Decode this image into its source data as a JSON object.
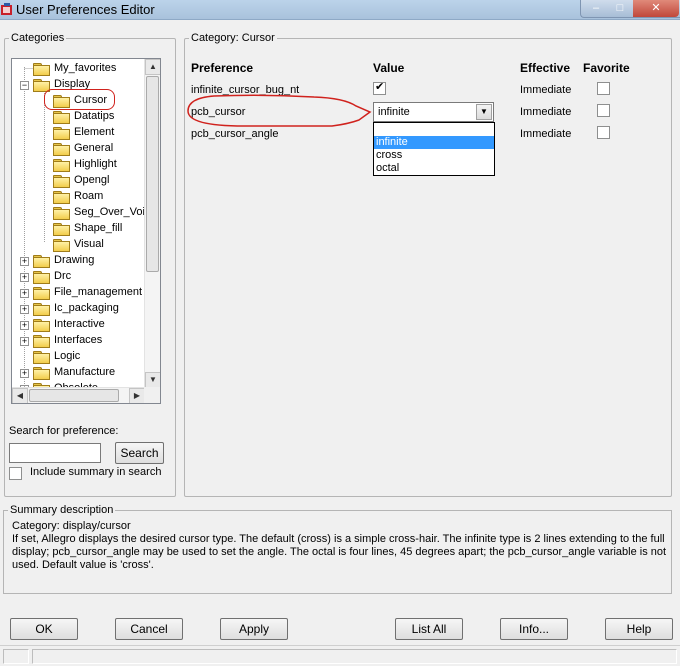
{
  "window": {
    "title": "User Preferences Editor",
    "minimize": "–",
    "maximize": "□",
    "close": "✕"
  },
  "categories": {
    "legend": "Categories",
    "tree": [
      {
        "label": "My_favorites",
        "level": 0,
        "expander": ""
      },
      {
        "label": "Display",
        "level": 0,
        "expander": "−"
      },
      {
        "label": "Cursor",
        "level": 1,
        "expander": "",
        "selected": true
      },
      {
        "label": "Datatips",
        "level": 1,
        "expander": ""
      },
      {
        "label": "Element",
        "level": 1,
        "expander": ""
      },
      {
        "label": "General",
        "level": 1,
        "expander": ""
      },
      {
        "label": "Highlight",
        "level": 1,
        "expander": ""
      },
      {
        "label": "Opengl",
        "level": 1,
        "expander": ""
      },
      {
        "label": "Roam",
        "level": 1,
        "expander": ""
      },
      {
        "label": "Seg_Over_Voi",
        "level": 1,
        "expander": ""
      },
      {
        "label": "Shape_fill",
        "level": 1,
        "expander": ""
      },
      {
        "label": "Visual",
        "level": 1,
        "expander": ""
      },
      {
        "label": "Drawing",
        "level": 0,
        "expander": "+"
      },
      {
        "label": "Drc",
        "level": 0,
        "expander": "+"
      },
      {
        "label": "File_management",
        "level": 0,
        "expander": "+"
      },
      {
        "label": "Ic_packaging",
        "level": 0,
        "expander": "+"
      },
      {
        "label": "Interactive",
        "level": 0,
        "expander": "+"
      },
      {
        "label": "Interfaces",
        "level": 0,
        "expander": "+"
      },
      {
        "label": "Logic",
        "level": 0,
        "expander": ""
      },
      {
        "label": "Manufacture",
        "level": 0,
        "expander": "+"
      },
      {
        "label": "Obsolete",
        "level": 0,
        "expander": "+"
      }
    ],
    "search_label": "Search for preference:",
    "search_value": "",
    "search_button": "Search",
    "include_summary": "Include summary in search"
  },
  "category_panel": {
    "legend": "Category:  Cursor",
    "headers": {
      "preference": "Preference",
      "value": "Value",
      "effective": "Effective",
      "favorite": "Favorite"
    },
    "rows": [
      {
        "preference": "infinite_cursor_bug_nt",
        "value_type": "checkbox",
        "checked": true,
        "effective": "Immediate",
        "favorite": false
      },
      {
        "preference": "pcb_cursor",
        "value_type": "combo",
        "value": "infinite",
        "effective": "Immediate",
        "favorite": false
      },
      {
        "preference": "pcb_cursor_angle",
        "value_type": "text",
        "value": "",
        "effective": "Immediate",
        "favorite": false
      }
    ],
    "dropdown_options": [
      "",
      "infinite",
      "cross",
      "octal"
    ],
    "dropdown_highlighted": "infinite"
  },
  "summary": {
    "legend": "Summary description",
    "category_line": "Category: display/cursor",
    "text": "If set, Allegro displays the desired cursor type. The default (cross) is a simple cross-hair. The infinite type is 2 lines extending to the full display; pcb_cursor_angle may be used to set the angle. The octal is four lines, 45 degrees apart; the pcb_cursor_angle variable is not used. Default value is 'cross'."
  },
  "buttons": {
    "ok": "OK",
    "cancel": "Cancel",
    "apply": "Apply",
    "list_all": "List All",
    "info": "Info...",
    "help": "Help"
  },
  "colors": {
    "highlight": "#3399ff",
    "annotation_red": "#d0221d"
  }
}
